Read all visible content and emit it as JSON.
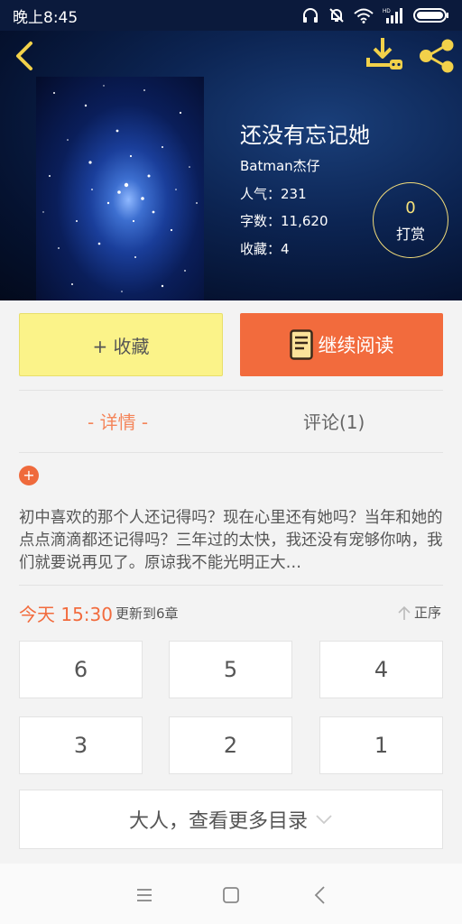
{
  "status_bar": {
    "time": "晚上8:45",
    "icons": [
      "headphones-icon",
      "alarm-off-icon",
      "wifi-icon",
      "hd-signal-icon",
      "battery-icon"
    ]
  },
  "header": {
    "back_icon": "chevron-left-icon",
    "download_icon": "download-icon",
    "share_icon": "share-icon",
    "accent_color": "#f2d14a"
  },
  "book": {
    "title": "还没有忘记她",
    "author": "Batman杰仔",
    "popularity": "人气：231",
    "word_count": "字数：11,620",
    "favorites": "收藏：4",
    "tip_count": "0",
    "tip_label": "打赏"
  },
  "actions": {
    "collect_label": "+ 收藏",
    "read_label": "继续阅读",
    "collect_color": "#fbf389",
    "read_color": "#f26b3d"
  },
  "tabs": [
    {
      "label": "- 详情 -",
      "active": true
    },
    {
      "label": "评论(1)",
      "active": false
    }
  ],
  "detail": {
    "expand_symbol": "+",
    "synopsis": "初中喜欢的那个人还记得吗？现在心里还有她吗？当年和她的点点滴滴都还记得吗？三年过的太快，我还没有宠够你呐，我们就要说再见了。原谅我不能光明正大…"
  },
  "catalog": {
    "update_time": "今天 15:30",
    "update_info": "更新到6章",
    "sort_label": "正序",
    "chapters": [
      "6",
      "5",
      "4",
      "3",
      "2",
      "1"
    ],
    "more_label": "大人，查看更多目录"
  },
  "nav_bar": {
    "icons": [
      "menu-icon",
      "home-icon",
      "back-icon"
    ]
  }
}
